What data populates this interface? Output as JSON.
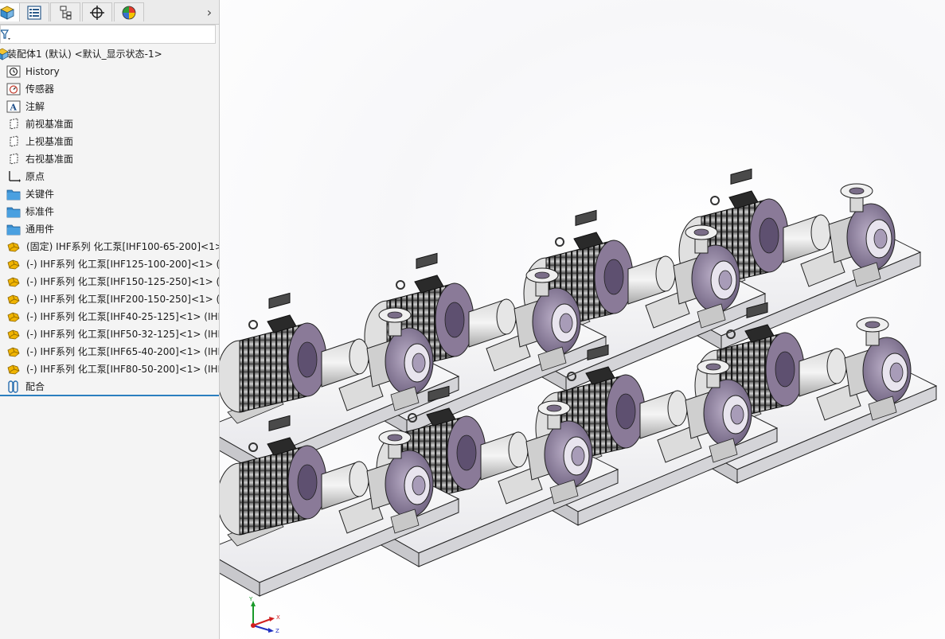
{
  "tabs": [
    {
      "name": "FeatureManager",
      "icon": "assembly-cube-icon"
    },
    {
      "name": "PropertyManager",
      "icon": "property-list-icon"
    },
    {
      "name": "ConfigurationManager",
      "icon": "configuration-icon"
    },
    {
      "name": "DimXpertManager",
      "icon": "crosshair-icon"
    },
    {
      "name": "DisplayManager",
      "icon": "display-pie-icon"
    }
  ],
  "more_tabs_glyph": "›",
  "tree": {
    "root": "装配体1 (默认) <默认_显示状态-1>",
    "items": [
      {
        "label": "History",
        "icon": "history-icon"
      },
      {
        "label": "传感器",
        "icon": "sensor-icon"
      },
      {
        "label": "注解",
        "icon": "annotation-icon"
      },
      {
        "label": "前视基准面",
        "icon": "plane-icon"
      },
      {
        "label": "上视基准面",
        "icon": "plane-icon"
      },
      {
        "label": "右视基准面",
        "icon": "plane-icon"
      },
      {
        "label": "原点",
        "icon": "origin-icon"
      },
      {
        "label": "关键件",
        "icon": "folder-icon"
      },
      {
        "label": "标准件",
        "icon": "folder-icon"
      },
      {
        "label": "通用件",
        "icon": "folder-icon"
      }
    ],
    "components": [
      "(固定) IHF系列 化工泵[IHF100-65-200]<1>",
      "(-) IHF系列 化工泵[IHF125-100-200]<1> (IH",
      "(-) IHF系列 化工泵[IHF150-125-250]<1> (IH",
      "(-) IHF系列 化工泵[IHF200-150-250]<1> (IH",
      "(-) IHF系列 化工泵[IHF40-25-125]<1> (IHF8",
      "(-) IHF系列 化工泵[IHF50-32-125]<1> (IHF8",
      "(-) IHF系列 化工泵[IHF65-40-200]<1> (IHF8",
      "(-) IHF系列 化工泵[IHF80-50-200]<1> (IHF8"
    ],
    "mates": "配合"
  },
  "triad": {
    "y": "Y",
    "x": "X",
    "z": "Z"
  },
  "colors": {
    "accent": "#2b7fbf",
    "folder": "#3a8fd0",
    "component": "#f0b400",
    "motor": "#3a3a3a",
    "pump_purple": "#8a7a98",
    "base": "#f1f1f3"
  }
}
